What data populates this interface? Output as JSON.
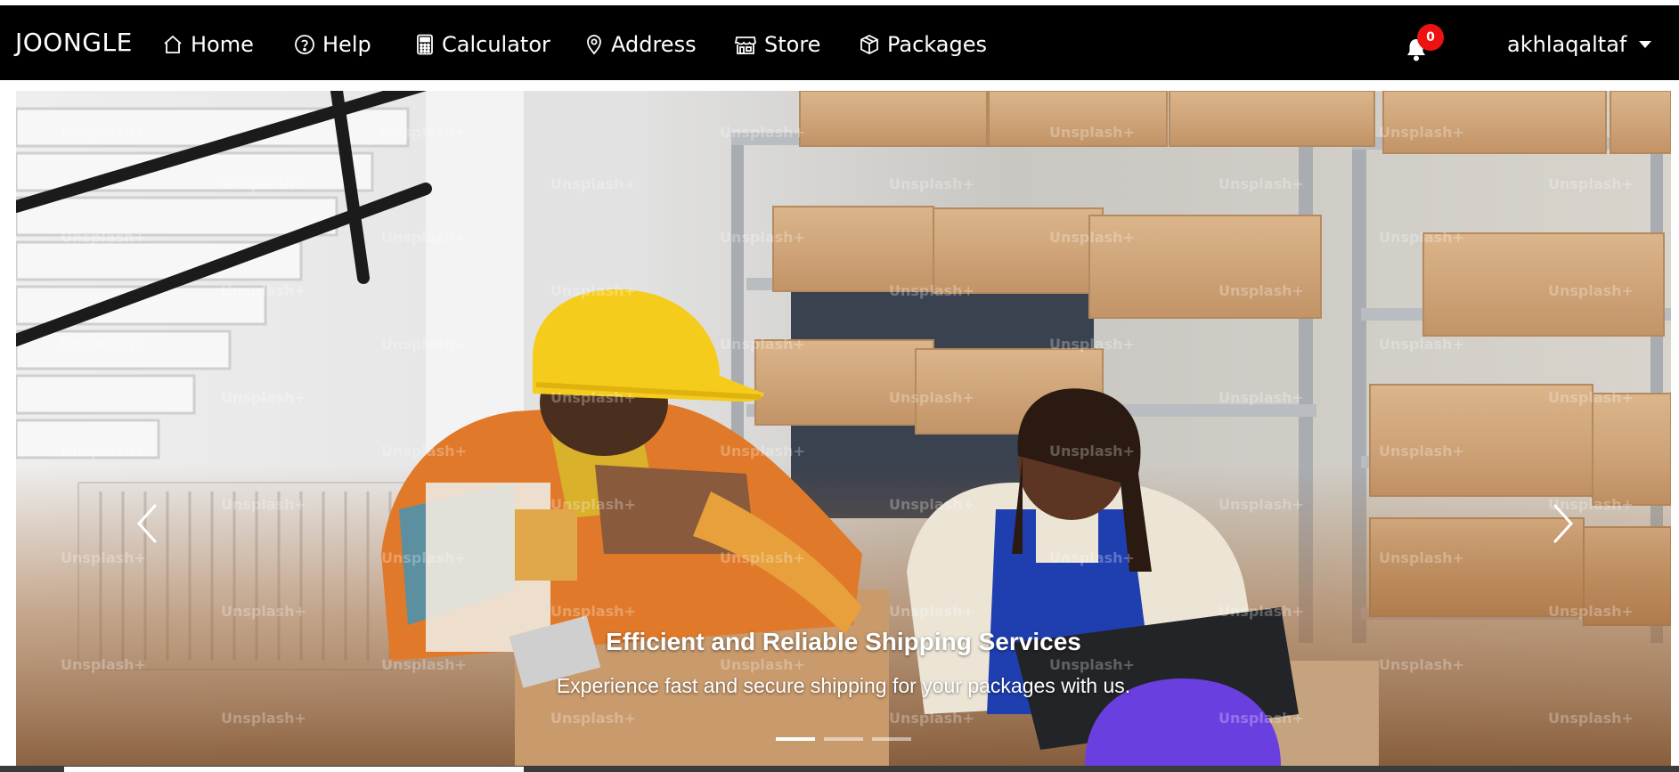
{
  "navbar": {
    "brand": "JOONGLE",
    "items": [
      {
        "label": "Home",
        "icon": "home-icon"
      },
      {
        "label": "Help",
        "icon": "help-circle-icon"
      },
      {
        "label": "Calculator",
        "icon": "calculator-icon"
      },
      {
        "label": "Address",
        "icon": "map-pin-icon"
      },
      {
        "label": "Store",
        "icon": "store-icon"
      },
      {
        "label": "Packages",
        "icon": "box-icon"
      }
    ],
    "notification_count": "0",
    "username": "akhlaqaltaf"
  },
  "carousel": {
    "title": "Efficient and Reliable Shipping Services",
    "text": "Experience fast and secure shipping for your packages with us.",
    "slides_total": 3,
    "active_slide": 1,
    "watermark": "Unsplash+"
  },
  "colors": {
    "navbar_bg": "#000000",
    "badge": "#ee1111",
    "helmet_yellow": "#f5cc1c",
    "overall_blue": "#1f3fb0",
    "box_brown": "#cda57c"
  }
}
